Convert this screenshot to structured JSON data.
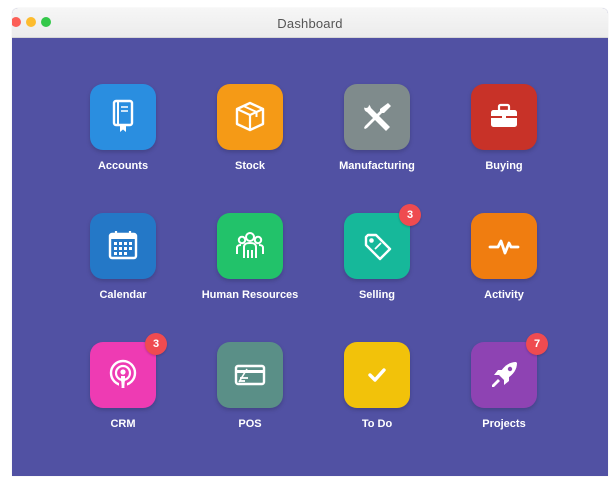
{
  "window": {
    "title": "Dashboard",
    "background_color": "#5151a3"
  },
  "apps": [
    {
      "label": "Accounts",
      "icon": "ledger-book-icon",
      "color": "#2a8ee0",
      "badge": ""
    },
    {
      "label": "Stock",
      "icon": "box-icon",
      "color": "#f59a16",
      "badge": ""
    },
    {
      "label": "Manufacturing",
      "icon": "wrench-screwdriver-icon",
      "color": "#7f8b8c",
      "badge": ""
    },
    {
      "label": "Buying",
      "icon": "briefcase-icon",
      "color": "#c83228",
      "badge": ""
    },
    {
      "label": "Calendar",
      "icon": "calendar-icon",
      "color": "#2478c7",
      "badge": ""
    },
    {
      "label": "Human Resources",
      "icon": "people-group-icon",
      "color": "#22c26a",
      "badge": ""
    },
    {
      "label": "Selling",
      "icon": "price-tag-icon",
      "color": "#16b89a",
      "badge": "3"
    },
    {
      "label": "Activity",
      "icon": "pulse-icon",
      "color": "#f07d10",
      "badge": ""
    },
    {
      "label": "CRM",
      "icon": "podcast-icon",
      "color": "#ee3bb3",
      "badge": "3"
    },
    {
      "label": "POS",
      "icon": "credit-card-icon",
      "color": "#5a8f87",
      "badge": ""
    },
    {
      "label": "To Do",
      "icon": "checkmark-icon",
      "color": "#f2c20a",
      "badge": ""
    },
    {
      "label": "Projects",
      "icon": "rocket-icon",
      "color": "#8e43b3",
      "badge": "7"
    }
  ]
}
